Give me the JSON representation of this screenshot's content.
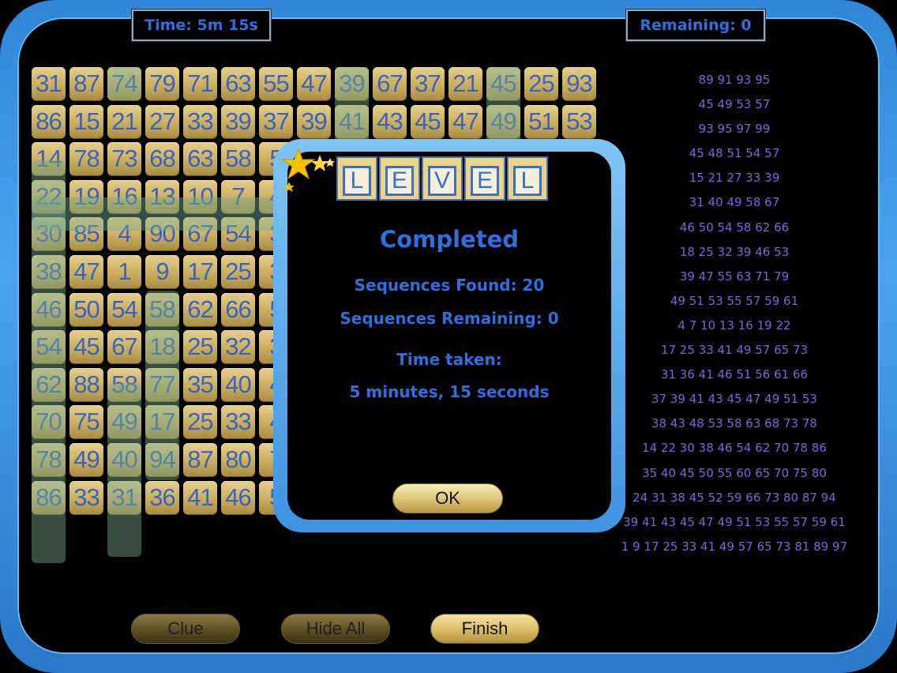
{
  "header": {
    "time_label": "Time: 5m 15s",
    "remaining_label": "Remaining: 0"
  },
  "grid": {
    "rows": [
      [
        "31",
        "87",
        "74",
        "79",
        "71",
        "63",
        "55",
        "47",
        "39",
        "67",
        "37",
        "21",
        "45",
        "25",
        "93"
      ],
      [
        "86",
        "15",
        "21",
        "27",
        "33",
        "39",
        "37",
        "39",
        "41",
        "43",
        "45",
        "47",
        "49",
        "51",
        "53"
      ],
      [
        "14",
        "78",
        "73",
        "68",
        "63",
        "58",
        "5",
        "",
        "",
        "",
        "",
        "",
        "",
        "",
        ""
      ],
      [
        "22",
        "19",
        "16",
        "13",
        "10",
        "7",
        "4",
        "",
        "",
        "",
        "",
        "",
        "",
        "",
        ""
      ],
      [
        "30",
        "85",
        "4",
        "90",
        "67",
        "54",
        "3",
        "",
        "",
        "",
        "",
        "",
        "",
        "",
        ""
      ],
      [
        "38",
        "47",
        "1",
        "9",
        "17",
        "25",
        "3",
        "",
        "",
        "",
        "",
        "",
        "",
        "",
        ""
      ],
      [
        "46",
        "50",
        "54",
        "58",
        "62",
        "66",
        "5",
        "",
        "",
        "",
        "",
        "",
        "",
        "",
        ""
      ],
      [
        "54",
        "45",
        "67",
        "18",
        "25",
        "32",
        "3",
        "",
        "",
        "",
        "",
        "",
        "",
        "",
        ""
      ],
      [
        "62",
        "88",
        "58",
        "77",
        "35",
        "40",
        "4",
        "",
        "",
        "",
        "",
        "",
        "",
        "",
        ""
      ],
      [
        "70",
        "75",
        "49",
        "17",
        "25",
        "33",
        "4",
        "",
        "",
        "",
        "",
        "",
        "",
        "",
        ""
      ],
      [
        "78",
        "49",
        "40",
        "94",
        "87",
        "80",
        "7",
        "",
        "",
        "",
        "",
        "",
        "",
        "",
        ""
      ],
      [
        "86",
        "33",
        "31",
        "36",
        "41",
        "46",
        "5",
        "",
        "",
        "",
        "",
        "",
        "",
        "",
        ""
      ]
    ]
  },
  "sequences": [
    "89 91 93 95",
    "45 49 53 57",
    "93 95 97 99",
    "45 48 51 54 57",
    "15 21 27 33 39",
    "31 40 49 58 67",
    "46 50 54 58 62 66",
    "18 25 32 39 46 53",
    "39 47 55 63 71 79",
    "49 51 53 55 57 59 61",
    "4 7 10 13 16 19 22",
    "17 25 33 41 49 57 65 73",
    "31 36 41 46 51 56 61 66",
    "37 39 41 43 45 47 49 51 53",
    "38 43 48 53 58 63 68 73 78",
    "14 22 30 38 46 54 62 70 78 86",
    "35 40 45 50 55 60 65 70 75 80",
    "24 31 38 45 52 59 66 73 80 87 94",
    "39 41 43 45 47 49 51 53 55 57 59 61",
    "1 9 17 25 33 41 49 57 65 73 81 89 97"
  ],
  "buttons": {
    "clue": "Clue",
    "hide_all": "Hide All",
    "finish": "Finish"
  },
  "dialog": {
    "logo_letters": [
      "L",
      "E",
      "V",
      "E",
      "L"
    ],
    "title": "Completed",
    "found": "Sequences Found: 20",
    "remaining": "Sequences Remaining: 0",
    "time_label": "Time taken:",
    "time_value": "5 minutes, 15 seconds",
    "ok": "OK"
  }
}
